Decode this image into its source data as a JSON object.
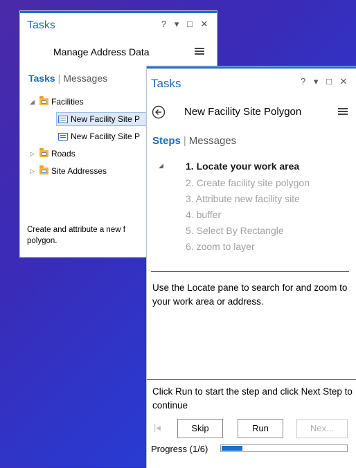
{
  "back_pane": {
    "title": "Tasks",
    "controls": [
      "?",
      "▾",
      "□",
      "✕"
    ],
    "header": "Manage Address Data",
    "tabs": {
      "active": "Tasks",
      "inactive": "Messages"
    },
    "tree": [
      {
        "label": "Facilities",
        "type": "folder",
        "expanded": true
      },
      {
        "label": "New Facility Site P",
        "type": "task",
        "selected": true
      },
      {
        "label": "New Facility Site P",
        "type": "task",
        "selected": false
      },
      {
        "label": "Roads",
        "type": "folder",
        "expanded": false
      },
      {
        "label": "Site Addresses",
        "type": "folder",
        "expanded": false
      }
    ],
    "description_line1": "Create and attribute a new f",
    "description_line2": "polygon."
  },
  "front_pane": {
    "title": "Tasks",
    "controls": [
      "?",
      "▾",
      "□",
      "✕"
    ],
    "header": "New Facility Site Polygon",
    "tabs": {
      "active": "Steps",
      "inactive": "Messages"
    },
    "steps": [
      "1. Locate your work area",
      "2. Create facility site  polygon",
      "3. Attribute new facility site",
      "4. buffer",
      "5. Select By Rectangle",
      "6. zoom to layer"
    ],
    "instruction": "Use the Locate pane to search for and zoom to your work area or address.",
    "run_hint": "Click Run to start the step and click Next Step to continue",
    "buttons": {
      "skip": "Skip",
      "run": "Run",
      "next": "Nex..."
    },
    "progress": {
      "label": "Progress (1/6)",
      "fraction": 0.1667
    },
    "colors": {
      "accent": "#1e69b6",
      "progress": "#1f6fc8"
    }
  }
}
